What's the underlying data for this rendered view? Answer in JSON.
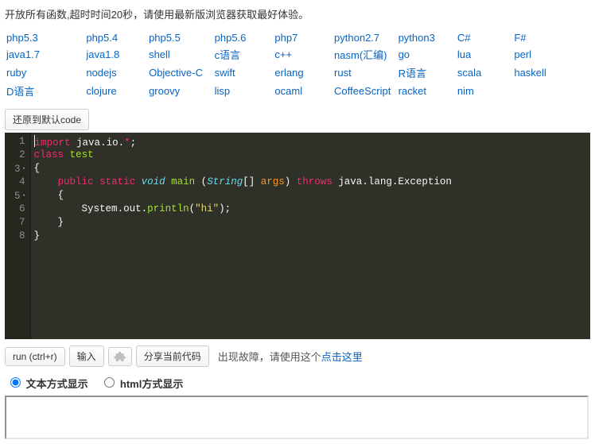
{
  "notice": "开放所有函数,超时时间20秒，请使用最新版浏览器获取最好体验。",
  "languages": [
    [
      "php5.3",
      "php5.4",
      "php5.5",
      "php5.6",
      "php7",
      "python2.7",
      "python3",
      "C#",
      "F#"
    ],
    [
      "java1.7",
      "java1.8",
      "shell",
      "c语言",
      "c++",
      "nasm(汇编)",
      "go",
      "lua",
      "perl"
    ],
    [
      "ruby",
      "nodejs",
      "Objective-C",
      "swift",
      "erlang",
      "rust",
      "R语言",
      "scala",
      "haskell"
    ],
    [
      "D语言",
      "clojure",
      "groovy",
      "lisp",
      "ocaml",
      "CoffeeScript",
      "racket",
      "nim",
      ""
    ]
  ],
  "buttons": {
    "restore": "还原到默认code",
    "run": "run (ctrl+r)",
    "input": "输入",
    "share": "分享当前代码"
  },
  "fault": {
    "prefix": "出现故障，请使用这个",
    "link": "点击这里"
  },
  "display": {
    "text": "文本方式显示",
    "html": "html方式显示"
  },
  "code_tokens": [
    [
      {
        "c": "tk-k",
        "t": "import"
      },
      {
        "c": "tk-d",
        "t": " java"
      },
      {
        "c": "tk-p",
        "t": "."
      },
      {
        "c": "tk-d",
        "t": "io"
      },
      {
        "c": "tk-p",
        "t": "."
      },
      {
        "c": "tk-k",
        "t": "*"
      },
      {
        "c": "tk-p",
        "t": ";"
      }
    ],
    [
      {
        "c": "tk-k",
        "t": "class"
      },
      {
        "c": "tk-d",
        "t": " "
      },
      {
        "c": "tk-c",
        "t": "test"
      }
    ],
    [
      {
        "c": "tk-p",
        "t": "{"
      }
    ],
    [
      {
        "c": "tk-d",
        "t": "    "
      },
      {
        "c": "tk-k",
        "t": "public"
      },
      {
        "c": "tk-d",
        "t": " "
      },
      {
        "c": "tk-k",
        "t": "static"
      },
      {
        "c": "tk-d",
        "t": " "
      },
      {
        "c": "tk-kd",
        "t": "void"
      },
      {
        "c": "tk-d",
        "t": " "
      },
      {
        "c": "tk-c",
        "t": "main"
      },
      {
        "c": "tk-d",
        "t": " "
      },
      {
        "c": "tk-p",
        "t": "("
      },
      {
        "c": "tk-kd",
        "t": "String"
      },
      {
        "c": "tk-p",
        "t": "[]"
      },
      {
        "c": "tk-d",
        "t": " "
      },
      {
        "c": "tk-nm",
        "t": "args"
      },
      {
        "c": "tk-p",
        "t": ")"
      },
      {
        "c": "tk-d",
        "t": " "
      },
      {
        "c": "tk-k",
        "t": "throws"
      },
      {
        "c": "tk-d",
        "t": " java"
      },
      {
        "c": "tk-p",
        "t": "."
      },
      {
        "c": "tk-d",
        "t": "lang"
      },
      {
        "c": "tk-p",
        "t": "."
      },
      {
        "c": "tk-d",
        "t": "Exception"
      }
    ],
    [
      {
        "c": "tk-d",
        "t": "    "
      },
      {
        "c": "tk-p",
        "t": "{"
      }
    ],
    [
      {
        "c": "tk-d",
        "t": "        System"
      },
      {
        "c": "tk-p",
        "t": "."
      },
      {
        "c": "tk-d",
        "t": "out"
      },
      {
        "c": "tk-p",
        "t": "."
      },
      {
        "c": "tk-c",
        "t": "println"
      },
      {
        "c": "tk-p",
        "t": "("
      },
      {
        "c": "tk-s",
        "t": "\"hi\""
      },
      {
        "c": "tk-p",
        "t": ");"
      }
    ],
    [
      {
        "c": "tk-d",
        "t": "    "
      },
      {
        "c": "tk-p",
        "t": "}"
      }
    ],
    [
      {
        "c": "tk-p",
        "t": "}"
      }
    ]
  ],
  "line_count": 8,
  "breakpoint_lines": [
    3,
    5
  ]
}
